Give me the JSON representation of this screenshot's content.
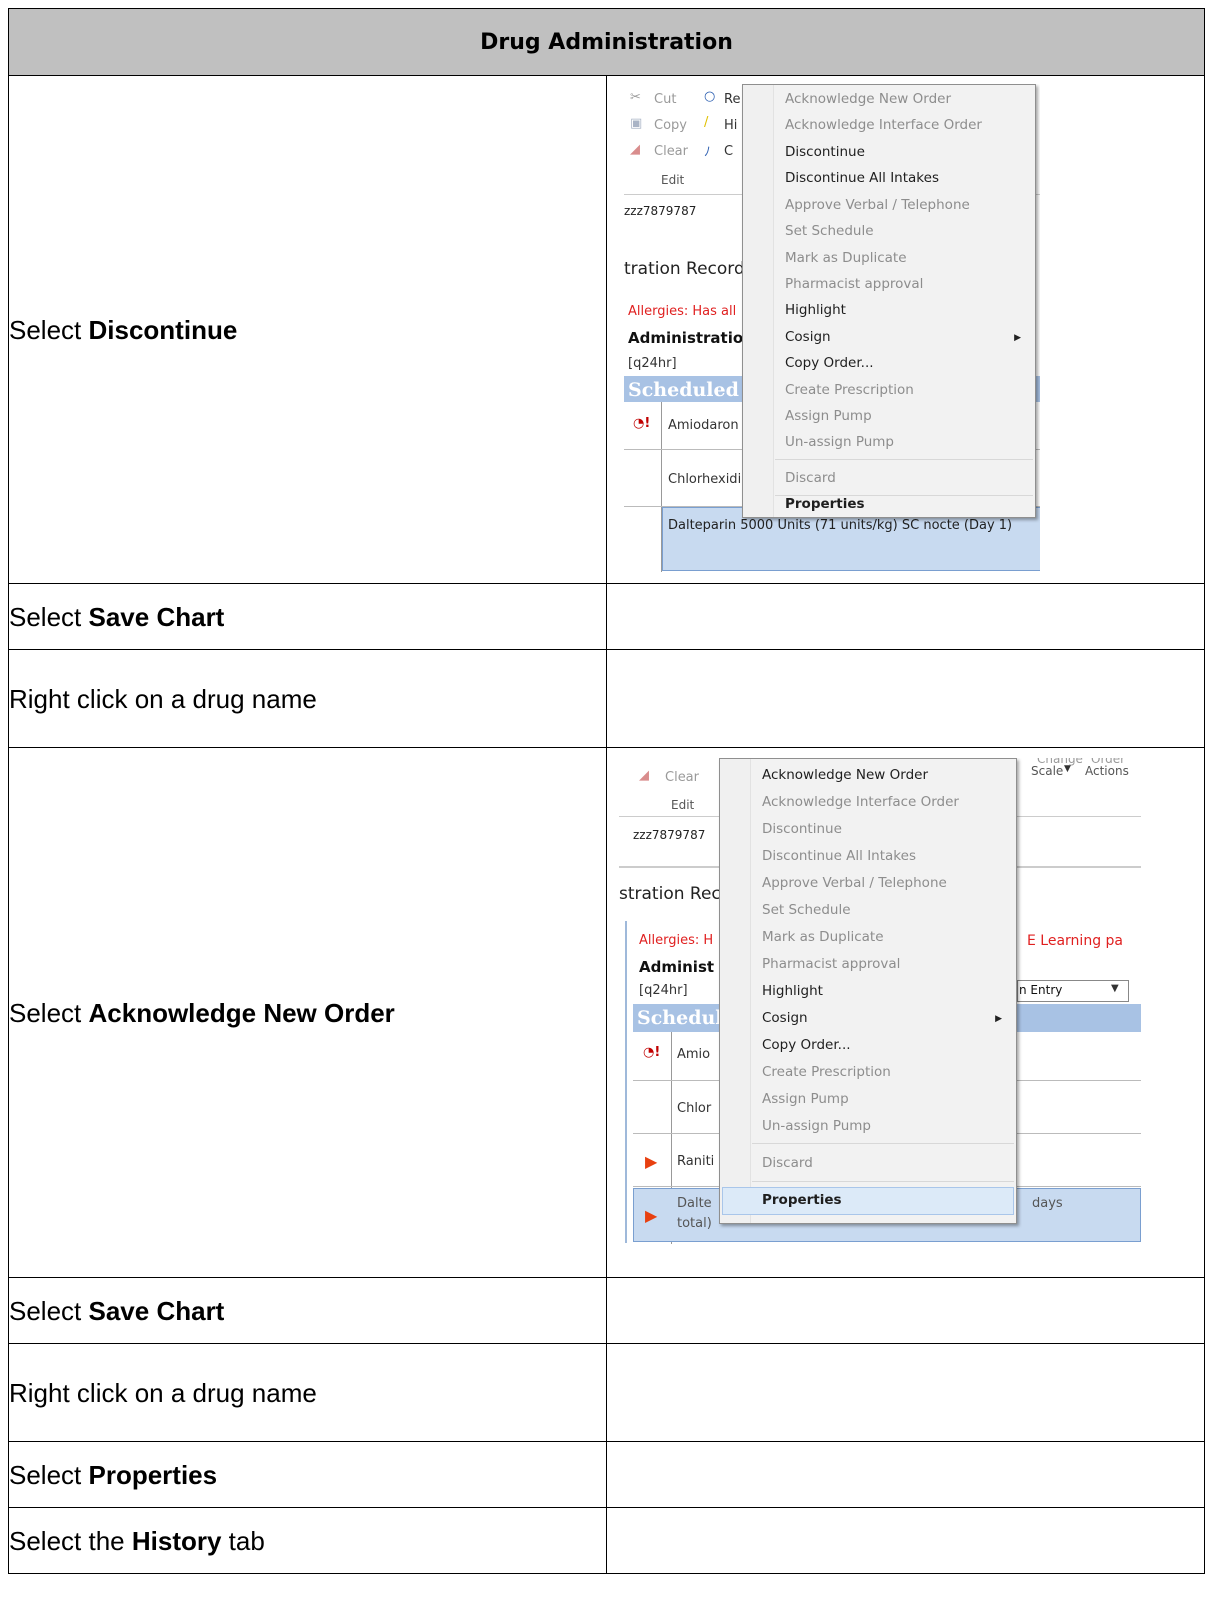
{
  "title": "Drug Administration",
  "rows": [
    {
      "prefix": "Select ",
      "bold": "Discontinue",
      "suffix": ""
    },
    {
      "prefix": "Select ",
      "bold": "Save Chart",
      "suffix": ""
    },
    {
      "prefix": "Right click on a drug name",
      "bold": "",
      "suffix": ""
    },
    {
      "prefix": "Select ",
      "bold": "Acknowledge New Order",
      "suffix": ""
    },
    {
      "prefix": "Select ",
      "bold": "Save Chart",
      "suffix": ""
    },
    {
      "prefix": "Right click on a drug name",
      "bold": "",
      "suffix": ""
    },
    {
      "prefix": "Select ",
      "bold": "Properties",
      "suffix": ""
    },
    {
      "prefix": "Select the ",
      "bold": "History",
      "suffix": " tab"
    }
  ],
  "shot1": {
    "toolbar": {
      "cut": "Cut",
      "copy": "Copy",
      "clear": "Clear",
      "edit": "Edit",
      "re": "Re",
      "hi": "Hi",
      "c": "C"
    },
    "patient_id": "zzz7879787",
    "record": "tration Record (",
    "allergies": "Allergies: Has all",
    "administration": "Administratio",
    "freq": "[q24hr]",
    "scheduled": "Scheduled",
    "drug1": "Amiodaron",
    "drug2": "Chlorhexidi",
    "drug3": "Dalteparin 5000 Units (71 units/kg) SC nocte (Day 1)",
    "menu": {
      "ack_new": "Acknowledge New Order",
      "ack_iface": "Acknowledge Interface Order",
      "discontinue": "Discontinue",
      "disc_all": "Discontinue All Intakes",
      "approve": "Approve Verbal / Telephone",
      "schedule": "Set Schedule",
      "duplicate": "Mark as Duplicate",
      "pharm": "Pharmacist approval",
      "highlight": "Highlight",
      "cosign": "Cosign",
      "copy_order": "Copy Order...",
      "prescription": "Create Prescription",
      "assign": "Assign Pump",
      "unassign": "Un-assign Pump",
      "discard": "Discard",
      "properties": "Properties"
    }
  },
  "shot2": {
    "toolbar": {
      "clear": "Clear",
      "edit": "Edit",
      "change_scale": "Scale",
      "order_actions": "Actions",
      "change_top": "Change",
      "order_top": "Order"
    },
    "patient_id": "zzz7879787",
    "record": "stration Rec",
    "allergies": "Allergies: H",
    "banner": "E Learning pa",
    "administration": "Administ",
    "freq": "[q24hr]",
    "entry": "n Entry",
    "scheduled": "Schedul",
    "drug1": "Amio",
    "drug2": "Chlor",
    "drug3": "Raniti",
    "drug4a": "Dalte",
    "drug4b": "days",
    "drug4c": "total)",
    "menu": {
      "ack_new": "Acknowledge New Order",
      "ack_iface": "Acknowledge Interface Order",
      "discontinue": "Discontinue",
      "disc_all": "Discontinue All Intakes",
      "approve": "Approve Verbal / Telephone",
      "schedule": "Set Schedule",
      "duplicate": "Mark as Duplicate",
      "pharm": "Pharmacist approval",
      "highlight": "Highlight",
      "cosign": "Cosign",
      "copy_order": "Copy Order...",
      "prescription": "Create Prescription",
      "assign": "Assign Pump",
      "unassign": "Un-assign Pump",
      "discard": "Discard",
      "properties": "Properties"
    }
  }
}
